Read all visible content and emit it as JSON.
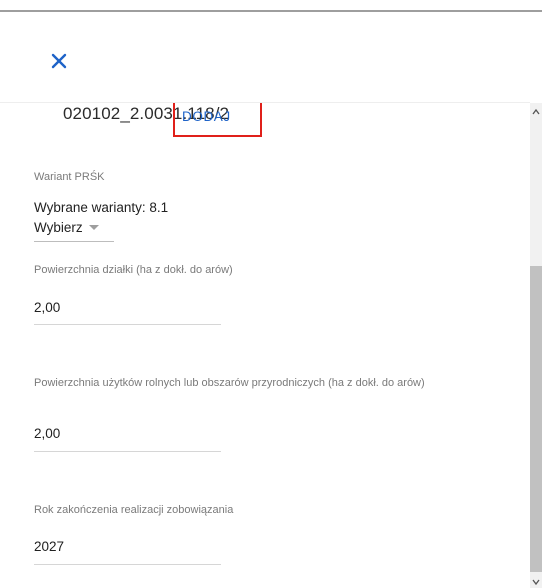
{
  "dialog": {
    "close_label": "×"
  },
  "item": {
    "code": "020102_2.0031.118/2",
    "add_label": "DODAJ"
  },
  "fields": {
    "variant": {
      "label": "Wariant PRŚK",
      "selected_text": "Wybrane warianty: 8.1",
      "select_label": "Wybierz"
    },
    "plot_area": {
      "label": "Powierzchnia działki (ha z dokł. do arów)",
      "value": "2,00"
    },
    "agri_area": {
      "label": "Powierzchnia użytków rolnych lub obszarów przyrodniczych (ha z dokł. do arów)",
      "value": "2,00"
    },
    "end_year": {
      "label": "Rok zakończenia realizacji zobowiązania",
      "value": "2027"
    }
  },
  "colors": {
    "accent": "#1e63c8",
    "highlight_border": "#e0201a"
  }
}
